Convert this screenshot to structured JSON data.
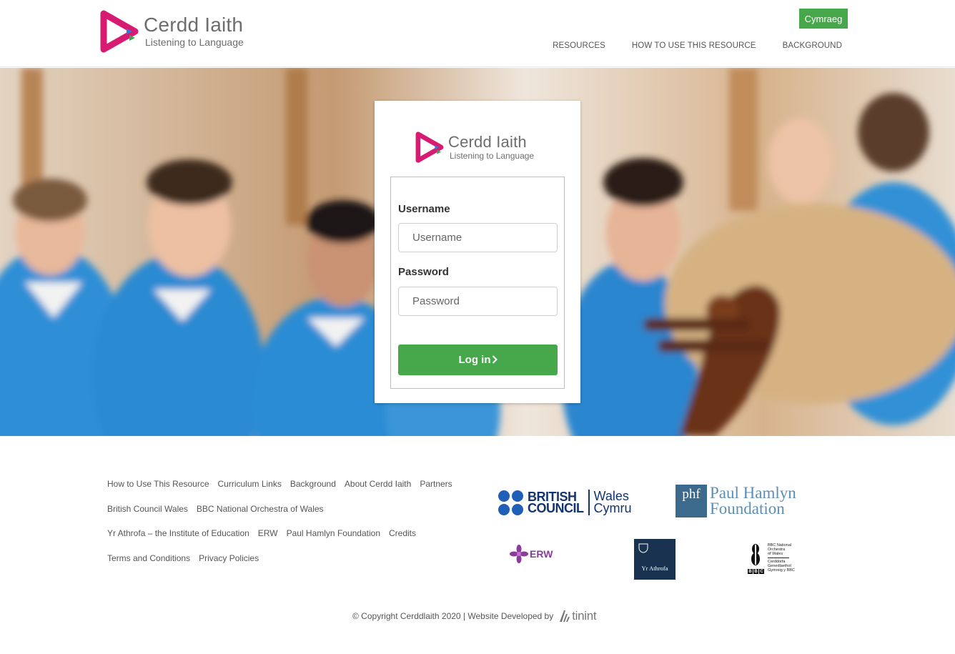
{
  "header": {
    "logo": {
      "name": "Cerdd Iaith",
      "tagline": "Listening to Language"
    },
    "language_button": "Cymraeg",
    "nav": [
      "RESOURCES",
      "HOW TO USE THIS RESOURCE",
      "BACKGROUND"
    ]
  },
  "login": {
    "logo": {
      "name": "Cerdd Iaith",
      "tagline": "Listening to Language"
    },
    "username": {
      "label": "Username",
      "placeholder": "Username",
      "value": ""
    },
    "password": {
      "label": "Password",
      "placeholder": "Password",
      "value": ""
    },
    "submit": "Log in",
    "submit_icon": "chevron-right-icon"
  },
  "footer": {
    "links": [
      [
        "How to Use This Resource",
        "Curriculum Links",
        "Background",
        "About Cerdd Iaith",
        "Partners"
      ],
      [
        "British Council Wales",
        "BBC National Orchestra of Wales"
      ],
      [
        "Yr Athrofa – the Institute of Education",
        "ERW",
        "Paul Hamlyn Foundation",
        "Credits"
      ],
      [
        "Terms and Conditions",
        "Privacy Policies"
      ]
    ],
    "partners": {
      "british_council": {
        "line1": "BRITISH",
        "line2": "COUNCIL",
        "line3": "Wales",
        "line4": "Cymru"
      },
      "phf": {
        "mark": "phf",
        "line1": "Paul Hamlyn",
        "line2": "Foundation"
      },
      "erw": {
        "mark": "ERW"
      },
      "athrofa": {
        "name": "Yr Athrofa"
      },
      "bbc_now": {
        "line1": "BBC National",
        "line2": "Orchestra",
        "line3": "of Wales",
        "line4": "Cerddorfa",
        "line5": "Genedlaethol",
        "line6": "Gymreig y BBC",
        "blocks": [
          "B",
          "B",
          "C"
        ]
      }
    },
    "copyright": "© Copyright Cerddlaith 2020 | Website Developed by",
    "developer": "tinint"
  },
  "colors": {
    "accent_green": "#46a84b",
    "logo_magenta": "#d81b72",
    "logo_blue": "#2e7bd6",
    "logo_green": "#3aa84a"
  }
}
